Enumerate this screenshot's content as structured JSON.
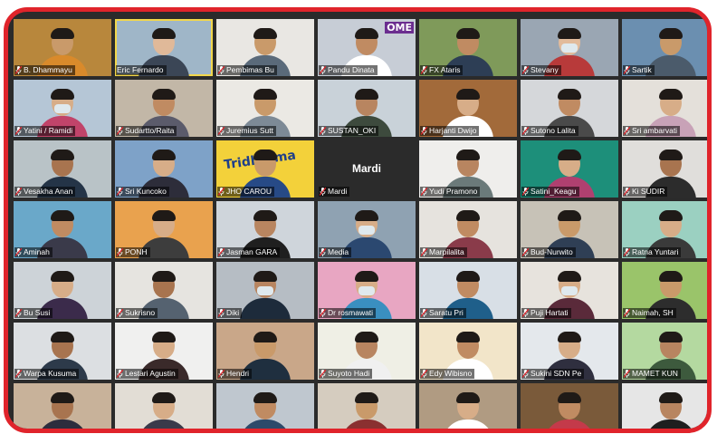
{
  "meeting": {
    "participants": [
      {
        "name": "B. Dhammayu",
        "bg": "#b8873c",
        "skin": "#c99a6a",
        "shirt": "#d98a2b",
        "muted": true
      },
      {
        "name": "Eric Fernardo",
        "bg": "#9fb6c8",
        "skin": "#e0b999",
        "shirt": "#3b4656",
        "muted": false,
        "active": true
      },
      {
        "name": "Pembimas Bu",
        "bg": "#e9e7e3",
        "skin": "#c99a6a",
        "shirt": "#5a6a7a",
        "muted": true
      },
      {
        "name": "Pandu Dinata",
        "bg": "#c7cdd6",
        "skin": "#c08b62",
        "shirt": "#ffffff",
        "muted": true,
        "overlay": "OME",
        "overlay_bg": "#6b2d8f"
      },
      {
        "name": "FX Ataris",
        "bg": "#7f9a5a",
        "skin": "#c08b62",
        "shirt": "#2d3e55",
        "muted": true
      },
      {
        "name": "Stevany",
        "bg": "#9aa6b3",
        "skin": "#e2bb9b",
        "shirt": "#b83a3a",
        "muted": true,
        "mask": true
      },
      {
        "name": "Sartik",
        "bg": "#6b8fb0",
        "skin": "#c99a6a",
        "shirt": "#4b5b6b",
        "muted": true
      },
      {
        "name": "Yatini / Ramidi",
        "bg": "#b5c6d6",
        "skin": "#d7ad88",
        "shirt": "#c1446a",
        "muted": true,
        "mask": true
      },
      {
        "name": "Sudartto/Raita",
        "bg": "#c2b7a7",
        "skin": "#c08b62",
        "shirt": "#5b5b6b",
        "muted": true
      },
      {
        "name": "Juremius Sutt",
        "bg": "#ebe9e4",
        "skin": "#c99a6a",
        "shirt": "#7d8a96",
        "muted": true
      },
      {
        "name": "SUSTAN_OKI",
        "bg": "#c9d2d9",
        "skin": "#b88560",
        "shirt": "#3d4a3d",
        "muted": true
      },
      {
        "name": "Harjanti Dwijo",
        "bg": "#a26a3a",
        "skin": "#d7ad88",
        "shirt": "#ffffff",
        "muted": true
      },
      {
        "name": "Sutono Lalita",
        "bg": "#d5d7da",
        "skin": "#c08b62",
        "shirt": "#4a4a4a",
        "muted": true
      },
      {
        "name": "Sri ambarvati",
        "bg": "#e4e0da",
        "skin": "#d7ad88",
        "shirt": "#c8a2b7",
        "muted": true
      },
      {
        "name": "Vesakha Anan",
        "bg": "#b9c3c7",
        "skin": "#a8744f",
        "shirt": "#243447",
        "muted": true
      },
      {
        "name": "Sri Kuncoko",
        "bg": "#7ea2c8",
        "skin": "#d7ad88",
        "shirt": "#2d2d3a",
        "muted": true
      },
      {
        "name": "JHO CAROU",
        "bg": "#f3d13a",
        "skin": "#c99a6a",
        "shirt": "#274a86",
        "muted": true,
        "overlay": "Tridharma",
        "overlay_bg": "#f3d13a"
      },
      {
        "name": "Mardi",
        "bg": "#2b2b2b",
        "muted": true,
        "name_only": true
      },
      {
        "name": "Yudi Pramono",
        "bg": "#efeeec",
        "skin": "#b88560",
        "shirt": "#6b7a7a",
        "muted": true
      },
      {
        "name": "Satini_Keagu",
        "bg": "#1d8f7a",
        "skin": "#d7ad88",
        "shirt": "#b04070",
        "muted": true
      },
      {
        "name": "Ki SUDIR",
        "bg": "#e0dedb",
        "skin": "#a8744f",
        "shirt": "#2c2c2c",
        "muted": true
      },
      {
        "name": "Aminah",
        "bg": "#6aa8c9",
        "skin": "#c08b62",
        "shirt": "#3a3a4a",
        "muted": true
      },
      {
        "name": "PONH",
        "bg": "#e9a24e",
        "skin": "#d7ad88",
        "shirt": "#3d3d3d",
        "muted": true
      },
      {
        "name": "Jasman GARA",
        "bg": "#cfd5db",
        "skin": "#b88560",
        "shirt": "#1f1f1f",
        "muted": true
      },
      {
        "name": "Media",
        "bg": "#8fa2b2",
        "skin": "#d7ad88",
        "shirt": "#2b4870",
        "muted": true,
        "mask": true
      },
      {
        "name": "Marpilalita",
        "bg": "#e6e3de",
        "skin": "#c08b62",
        "shirt": "#8a3b4a",
        "muted": true
      },
      {
        "name": "Bud-Nurwito",
        "bg": "#c7c2b7",
        "skin": "#c99a6a",
        "shirt": "#2f3f55",
        "muted": true
      },
      {
        "name": "Ratna Yuntari",
        "bg": "#9bd0c1",
        "skin": "#d7ad88",
        "shirt": "#3a3a3a",
        "muted": true
      },
      {
        "name": "Bu Susi",
        "bg": "#cdd3d8",
        "skin": "#d7ad88",
        "shirt": "#3b2b4b",
        "muted": true
      },
      {
        "name": "Sukrisno",
        "bg": "#e6e4e0",
        "skin": "#a8744f",
        "shirt": "#556270",
        "muted": true
      },
      {
        "name": "Diki",
        "bg": "#b6bdc4",
        "skin": "#b88560",
        "shirt": "#1d2b3b",
        "muted": true,
        "mask": true
      },
      {
        "name": "Dr rosmawati",
        "bg": "#e8a6c2",
        "skin": "#d7ad88",
        "shirt": "#3a8fc0",
        "muted": true,
        "mask": true
      },
      {
        "name": "Saratu Pri",
        "bg": "#d8dfe6",
        "skin": "#c08b62",
        "shirt": "#1f5f8a",
        "muted": true
      },
      {
        "name": "Puji Hartati",
        "bg": "#e7e3dd",
        "skin": "#d7ad88",
        "shirt": "#5a2a3a",
        "muted": true,
        "mask": true
      },
      {
        "name": "Naimah, SH",
        "bg": "#9ac46a",
        "skin": "#c99a6a",
        "shirt": "#2d2d2d",
        "muted": true
      },
      {
        "name": "Warpa Kusuma",
        "bg": "#dcdfe2",
        "skin": "#a8744f",
        "shirt": "#2d3a4a",
        "muted": true
      },
      {
        "name": "Lestari Agustin",
        "bg": "#f0f0ef",
        "skin": "#d7ad88",
        "shirt": "#3a2a2a",
        "muted": true
      },
      {
        "name": "Hendri",
        "bg": "#c9a789",
        "skin": "#c99a6a",
        "shirt": "#1f2f3f",
        "muted": true
      },
      {
        "name": "Suyoto Hadi",
        "bg": "#efefe5",
        "skin": "#b88560",
        "shirt": "#f0f0f0",
        "muted": true
      },
      {
        "name": "Edy Wibisno",
        "bg": "#f2e5c9",
        "skin": "#c08b62",
        "shirt": "#ffffff",
        "muted": true
      },
      {
        "name": "Sukini SDN Pe",
        "bg": "#e4e8ec",
        "skin": "#d7ad88",
        "shirt": "#2f2f3f",
        "muted": true
      },
      {
        "name": "MAMET KUN",
        "bg": "#b4d9a0",
        "skin": "#b88560",
        "shirt": "#3d5a3d",
        "muted": true
      },
      {
        "name": "",
        "bg": "#c8b29a",
        "skin": "#a8744f",
        "shirt": "#2d2d3d",
        "muted": false
      },
      {
        "name": "",
        "bg": "#e2ddd5",
        "skin": "#d7ad88",
        "shirt": "#3a3a4a",
        "muted": false
      },
      {
        "name": "",
        "bg": "#bfc7cf",
        "skin": "#c08b62",
        "shirt": "#2d4a6a",
        "muted": false
      },
      {
        "name": "",
        "bg": "#d5ccbf",
        "skin": "#c99a6a",
        "shirt": "#8a3030",
        "muted": false
      },
      {
        "name": "",
        "bg": "#b09b82",
        "skin": "#d7ad88",
        "shirt": "#ffffff",
        "muted": false
      },
      {
        "name": "",
        "bg": "#7a5a3a",
        "skin": "#c08b62",
        "shirt": "#c43a4a",
        "muted": false
      },
      {
        "name": "",
        "bg": "#e6e6e6",
        "skin": "#b88560",
        "shirt": "#1f1f1f",
        "muted": false
      }
    ]
  }
}
